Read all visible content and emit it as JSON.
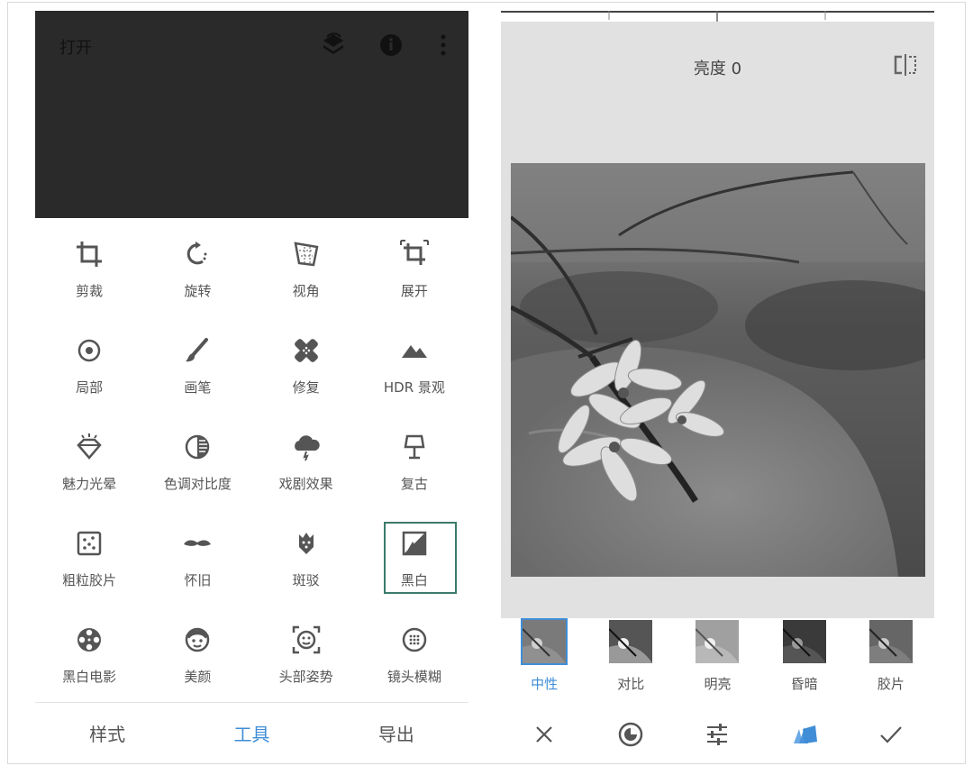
{
  "left": {
    "open_label": "打开",
    "top_icons": [
      "layers-icon",
      "info-icon",
      "more-vert-icon"
    ],
    "tools": [
      {
        "label": "剪裁",
        "icon": "crop-icon"
      },
      {
        "label": "旋转",
        "icon": "rotate-icon"
      },
      {
        "label": "视角",
        "icon": "perspective-icon"
      },
      {
        "label": "展开",
        "icon": "expand-icon"
      },
      {
        "label": "局部",
        "icon": "selective-icon"
      },
      {
        "label": "画笔",
        "icon": "brush-icon"
      },
      {
        "label": "修复",
        "icon": "healing-icon"
      },
      {
        "label": "HDR 景观",
        "icon": "hdr-mountain-icon"
      },
      {
        "label": "魅力光晕",
        "icon": "glamour-glow-icon"
      },
      {
        "label": "色调对比度",
        "icon": "tonal-contrast-icon"
      },
      {
        "label": "戏剧效果",
        "icon": "drama-cloud-icon"
      },
      {
        "label": "复古",
        "icon": "vintage-lamp-icon"
      },
      {
        "label": "粗粒胶片",
        "icon": "grainy-film-icon"
      },
      {
        "label": "怀旧",
        "icon": "mustache-icon"
      },
      {
        "label": "斑驳",
        "icon": "grunge-icon"
      },
      {
        "label": "黑白",
        "icon": "black-white-icon",
        "selected": true
      },
      {
        "label": "黑白电影",
        "icon": "film-reel-icon"
      },
      {
        "label": "美颜",
        "icon": "face-icon"
      },
      {
        "label": "头部姿势",
        "icon": "head-pose-icon"
      },
      {
        "label": "镜头模糊",
        "icon": "lens-blur-icon"
      }
    ],
    "nav": [
      {
        "label": "样式",
        "active": false
      },
      {
        "label": "工具",
        "active": true
      },
      {
        "label": "导出",
        "active": false
      }
    ]
  },
  "right": {
    "brightness_label": "亮度 0",
    "presets": [
      {
        "label": "中性",
        "selected": true
      },
      {
        "label": "对比",
        "selected": false
      },
      {
        "label": "明亮",
        "selected": false
      },
      {
        "label": "昏暗",
        "selected": false
      },
      {
        "label": "胶片",
        "selected": false
      }
    ],
    "actions": [
      "close-icon",
      "color-filter-icon",
      "tune-sliders-icon",
      "style-swatch-icon",
      "checkmark-icon"
    ]
  },
  "colors": {
    "accent": "#3f8dd6",
    "selected_border": "#3a7a6c",
    "topbar_bg": "#2a2a2a",
    "editor_bg": "#e1e1e1"
  }
}
